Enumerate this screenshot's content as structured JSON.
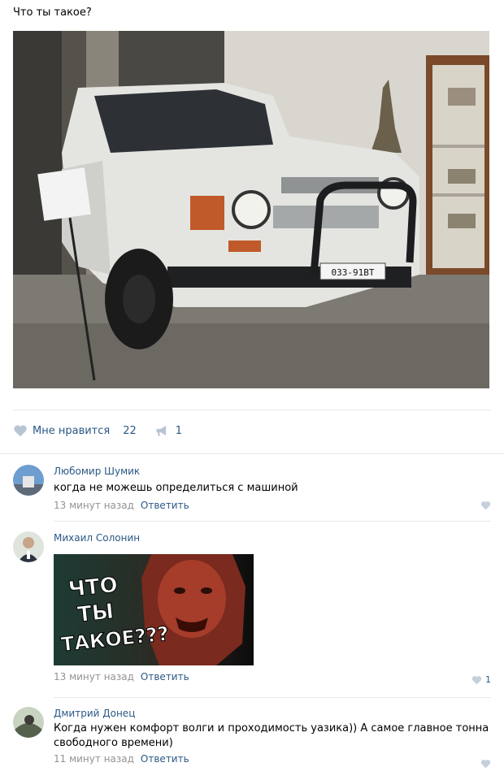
{
  "post": {
    "title": "Что ты такое?",
    "photo_alt": "UAZ car",
    "plate": "033-91ВТ",
    "likes_label": "Мне нравится",
    "likes_count": "22",
    "shares_count": "1"
  },
  "comments": [
    {
      "author": "Любомир Шумик",
      "text": "когда не можешь определиться с машиной",
      "time": "13 минут назад",
      "reply": "Ответить",
      "likes": ""
    },
    {
      "author": "Михаил Солонин",
      "text": "",
      "meme_text": [
        "ЧТО",
        "ТЫ",
        "ТАКОЕ???"
      ],
      "time": "13 минут назад",
      "reply": "Ответить",
      "likes": "1"
    },
    {
      "author": "Дмитрий Донец",
      "text": "Когда нужен комфорт волги и проходимость уазика)) А самое главное тонна свободного времени)",
      "time": "11 минут назад",
      "reply": "Ответить",
      "likes": ""
    }
  ],
  "colors": {
    "link": "#2a5885",
    "muted": "#939393",
    "divider": "#e7e8ec",
    "like_icon": "#b9c4d3"
  }
}
